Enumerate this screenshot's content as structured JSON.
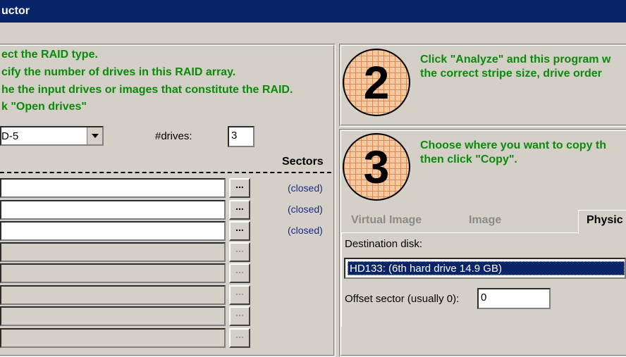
{
  "window": {
    "title": "uctor"
  },
  "step1": {
    "instructions": [
      "ect the RAID type.",
      "cify the number of drives in this RAID array.",
      "he the input drives or images that constitute the RAID.",
      "k \"Open drives\""
    ],
    "raid_type_value": "D-5",
    "drives_label": "#drives:",
    "drives_value": "3",
    "sectors_header": "Sectors",
    "browse_label": "...",
    "drive_status": [
      "(closed)",
      "(closed)",
      "(closed)"
    ]
  },
  "step2": {
    "number": "2",
    "text_lines": [
      "Click \"Analyze\" and this program w",
      "the correct stripe size, drive order"
    ]
  },
  "step3": {
    "number": "3",
    "text_lines": [
      "Choose where you want to copy th",
      "then click \"Copy\"."
    ],
    "tabs": [
      "Virtual Image",
      "Image",
      "Physic"
    ],
    "destination_label": "Destination disk:",
    "destination_value": "HD133: (6th hard drive 14.9 GB)",
    "offset_label": "Offset sector (usually 0):",
    "offset_value": "0"
  },
  "colors": {
    "title_bar": "#0a246a",
    "instruction_green": "#0b8a0b",
    "status_blue": "#1a2a8a",
    "face": "#d4d0c8"
  }
}
